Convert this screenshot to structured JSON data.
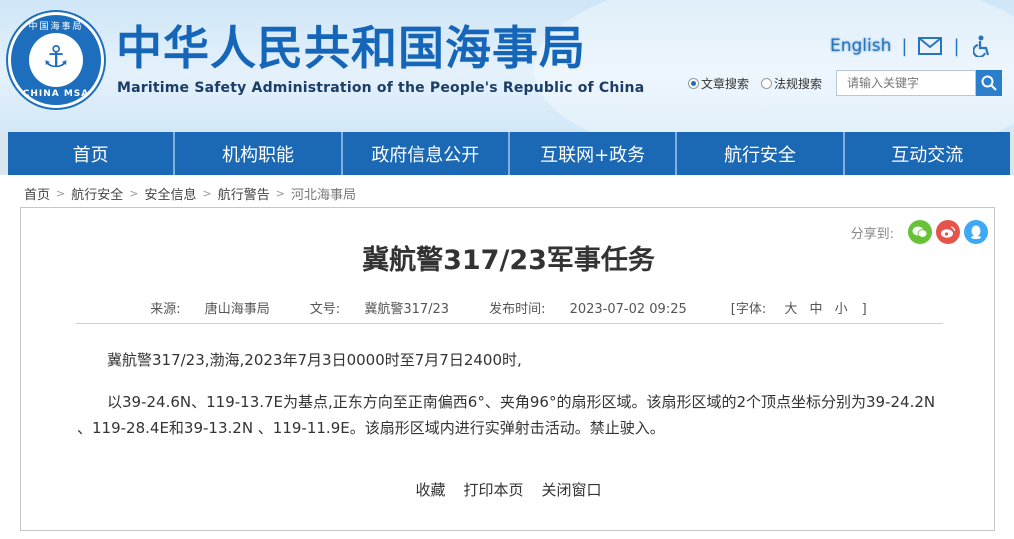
{
  "header": {
    "emblem_top_text": "中国海事局",
    "emblem_bottom_text": "CHINA MSA",
    "title_cn": "中华人民共和国海事局",
    "title_en": "Maritime Safety Administration of the People's Republic of China",
    "english_link": "English",
    "icons": [
      "mail-icon",
      "accessibility-icon"
    ],
    "search": {
      "radio_article": "文章搜索",
      "radio_law": "法规搜索",
      "selected": "文章搜索",
      "placeholder": "请输入关键字"
    }
  },
  "nav": {
    "items": [
      "首页",
      "机构职能",
      "政府信息公开",
      "互联网+政务",
      "航行安全",
      "互动交流"
    ]
  },
  "breadcrumb": [
    "首页",
    "航行安全",
    "安全信息",
    "航行警告",
    "河北海事局"
  ],
  "share": {
    "label": "分享到:",
    "icons": [
      "wechat-icon",
      "weibo-icon",
      "qq-icon"
    ]
  },
  "article": {
    "title": "冀航警317/23军事任务",
    "source_label": "来源:",
    "source": "唐山海事局",
    "docno_label": "文号:",
    "docno": "冀航警317/23",
    "date_label": "发布时间:",
    "date": "2023-07-02 09:25",
    "font_label": "[字体:",
    "font_large": "大",
    "font_medium": "中",
    "font_small": "小",
    "font_close": "]",
    "paragraph1": "冀航警317/23,渤海,2023年7月3日0000时至7月7日2400时,",
    "paragraph2": "以39-24.6N、119-13.7E为基点,正东方向至正南偏西6°、夹角96°的扇形区域。该扇形区域的2个顶点坐标分别为39-24.2N 、119-28.4E和39-13.2N 、119-11.9E。该扇形区域内进行实弹射击活动。禁止驶入。"
  },
  "actions": {
    "favorite": "收藏",
    "print": "打印本页",
    "close": "关闭窗口"
  }
}
